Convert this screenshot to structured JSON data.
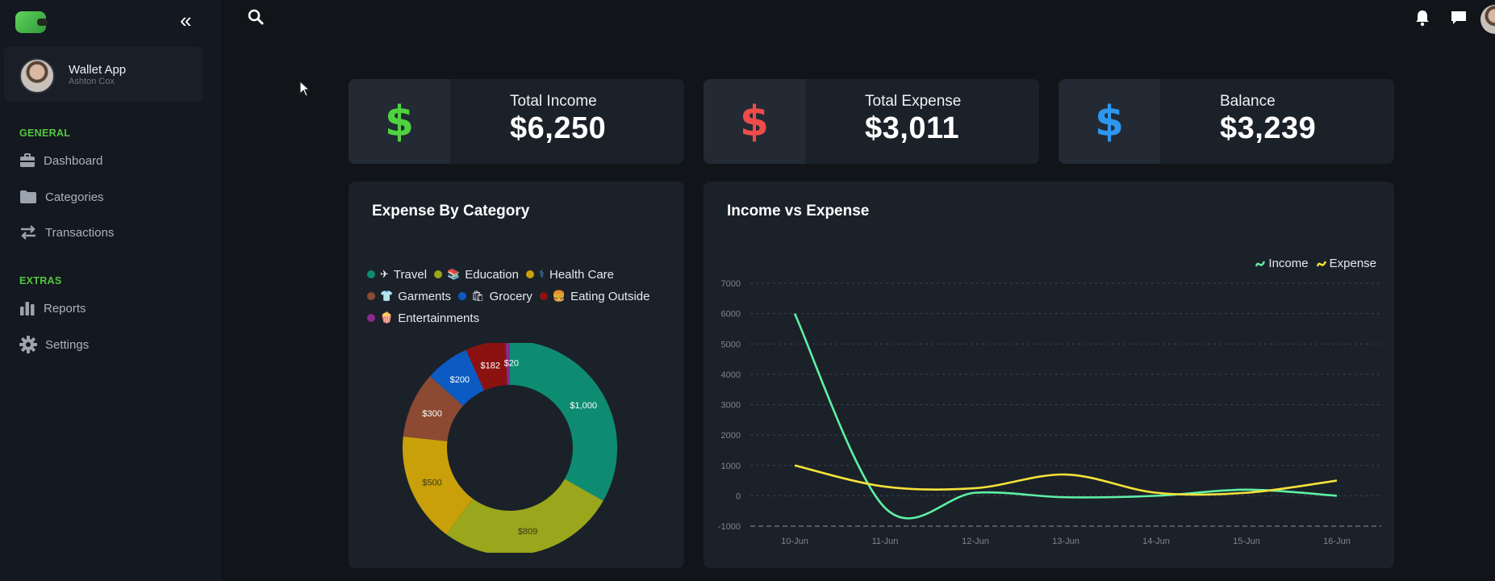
{
  "sidebar": {
    "profile": {
      "name": "Wallet App",
      "subtitle": "Ashton Cox"
    },
    "general_label": "GENERAL",
    "extras_label": "EXTRAS",
    "items": [
      {
        "label": "Dashboard",
        "icon": "briefcase-icon"
      },
      {
        "label": "Categories",
        "icon": "folder-icon"
      },
      {
        "label": "Transactions",
        "icon": "transfer-icon"
      },
      {
        "label": "Reports",
        "icon": "bar-chart-icon"
      },
      {
        "label": "Settings",
        "icon": "gear-icon"
      }
    ]
  },
  "cards": [
    {
      "label": "Total Income",
      "value": "$6,250",
      "symbol": "$",
      "color": "#4fd23f"
    },
    {
      "label": "Total Expense",
      "value": "$3,011",
      "symbol": "$",
      "color": "#ef4b4b"
    },
    {
      "label": "Balance",
      "value": "$3,239",
      "symbol": "$",
      "color": "#2d97f0"
    }
  ],
  "expense_panel": {
    "title": "Expense By Category",
    "legend": [
      {
        "label": "Travel",
        "color": "#0e8c72",
        "emoji": "✈"
      },
      {
        "label": "Education",
        "color": "#9aa61b",
        "emoji": "📚"
      },
      {
        "label": "Health Care",
        "color": "#c9a00a",
        "emoji": "⚕"
      },
      {
        "label": "Garments",
        "color": "#8b4a31",
        "emoji": "👕"
      },
      {
        "label": "Grocery",
        "color": "#0b5bc2",
        "emoji": "🛍"
      },
      {
        "label": "Eating Outside",
        "color": "#8c1212",
        "emoji": "🍔"
      },
      {
        "label": "Entertainments",
        "color": "#8a2a8e",
        "emoji": "🍿"
      }
    ]
  },
  "line_panel": {
    "title": "Income vs Expense",
    "legend": [
      {
        "label": "Income",
        "color": "#5ef0a6"
      },
      {
        "label": "Expense",
        "color": "#f5e23a"
      }
    ]
  },
  "chart_data": [
    {
      "type": "pie",
      "title": "Expense By Category",
      "categories": [
        "Travel",
        "Education",
        "Health Care",
        "Garments",
        "Grocery",
        "Eating Outside",
        "Entertainments"
      ],
      "values": [
        1000,
        809,
        500,
        300,
        200,
        182,
        20
      ],
      "data_labels": [
        "$1,000",
        "$809",
        "$500",
        "$300",
        "$200",
        "$182",
        "$20"
      ],
      "colors": [
        "#0e8c72",
        "#9aa61b",
        "#c9a00a",
        "#8b4a31",
        "#0b5bc2",
        "#8c1212",
        "#8a2a8e"
      ],
      "donut": true,
      "legend_position": "top"
    },
    {
      "type": "line",
      "title": "Income vs Expense",
      "x": [
        "10-Jun",
        "11-Jun",
        "12-Jun",
        "13-Jun",
        "14-Jun",
        "15-Jun",
        "16-Jun"
      ],
      "series": [
        {
          "name": "Income",
          "values": [
            6000,
            -400,
            100,
            -50,
            0,
            200,
            0
          ],
          "color": "#5ef0a6"
        },
        {
          "name": "Expense",
          "values": [
            1000,
            300,
            250,
            700,
            100,
            100,
            500
          ],
          "color": "#f5e23a"
        }
      ],
      "yticks": [
        "-1000",
        "0",
        "1000",
        "2000",
        "3000",
        "4000",
        "5000",
        "6000",
        "7000"
      ],
      "ylim": [
        -1000,
        7000
      ],
      "grid": true,
      "legend_position": "top-right",
      "smooth": true
    }
  ]
}
